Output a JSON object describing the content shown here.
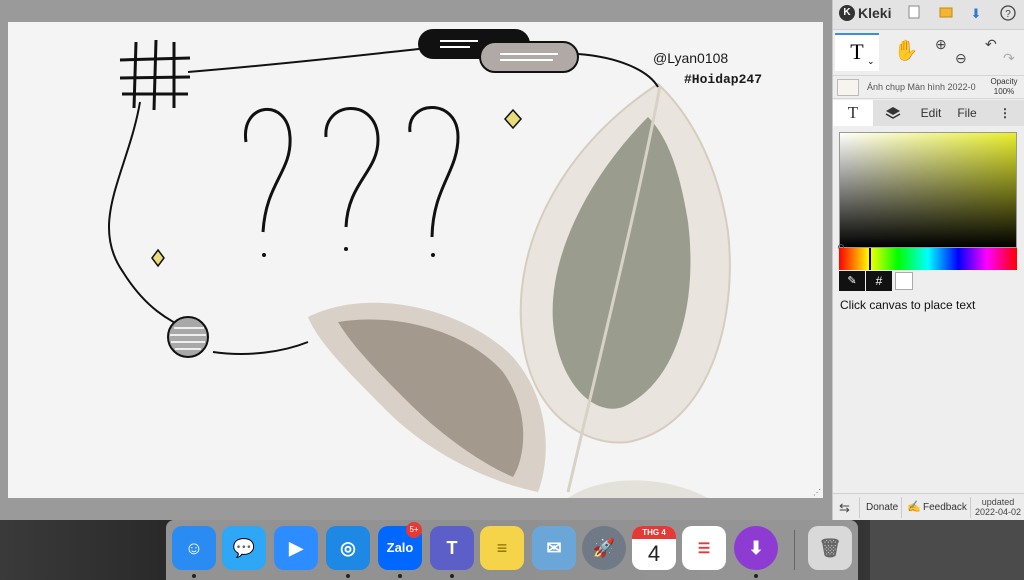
{
  "app": {
    "name": "Kleki"
  },
  "canvas": {
    "handle_text": "@Lyan0108",
    "hashtag_text": "#Hoidap247"
  },
  "toolbar": {
    "new_icon": "new-file-icon",
    "open_icon": "folder-icon",
    "download_icon": "download-icon",
    "help_icon": "help-icon",
    "text_tool_glyph": "T",
    "hand_icon": "hand-icon",
    "zoom_in_icon": "zoom-in-icon",
    "zoom_out_icon": "zoom-out-icon",
    "undo_icon": "undo-icon",
    "redo_icon": "redo-icon"
  },
  "layer": {
    "name": "Ảnh chụp Màn hình 2022-0",
    "opacity_label": "Opacity",
    "opacity_value": "100%"
  },
  "tabs": [
    {
      "label": "T",
      "active": true
    },
    {
      "label": "layers",
      "icon": "layers-icon"
    },
    {
      "label": "Edit"
    },
    {
      "label": "File"
    },
    {
      "label": "⋮",
      "icon": "more-icon"
    }
  ],
  "color": {
    "primary_hue": "#e8ee2c",
    "selected_color": "#000000",
    "secondary_color": "#ffffff",
    "hex_label": "#"
  },
  "hint": "Click canvas to place text",
  "footer": {
    "donate": "Donate",
    "feedback": "Feedback",
    "updated_label": "updated",
    "updated_date": "2022-04-02"
  },
  "dock": {
    "items": [
      {
        "name": "finder",
        "icon": "finder-icon",
        "color": "#2a8bf2",
        "running": true
      },
      {
        "name": "messages",
        "icon": "messages-icon",
        "color": "#2ea7f7",
        "running": false
      },
      {
        "name": "zoom",
        "icon": "zoom-icon",
        "color": "#2d8cff",
        "running": false
      },
      {
        "name": "safari",
        "icon": "safari-icon",
        "color": "#1e88e5",
        "running": true
      },
      {
        "name": "zalo",
        "label": "Zalo",
        "badge": "5+",
        "color": "#0068ff",
        "running": true
      },
      {
        "name": "teams",
        "label": "T",
        "color": "#5b5fc7",
        "running": true
      },
      {
        "name": "notes",
        "icon": "notes-icon",
        "color": "#f6d44a",
        "running": false
      },
      {
        "name": "mail",
        "icon": "mail-icon",
        "color": "#6aa7d8",
        "running": false
      },
      {
        "name": "launchpad",
        "icon": "rocket-icon",
        "color": "#707a86",
        "running": false
      },
      {
        "name": "calendar",
        "month": "THG 4",
        "day": "4",
        "color": "#ffffff",
        "running": false
      },
      {
        "name": "reminders",
        "icon": "reminders-icon",
        "color": "#ffffff",
        "running": false
      },
      {
        "name": "monterey",
        "icon": "installer-icon",
        "color": "#8e3bd4",
        "running": true
      },
      {
        "name": "trash",
        "icon": "trash-icon",
        "color": "#d9d9d9",
        "running": false
      }
    ]
  }
}
